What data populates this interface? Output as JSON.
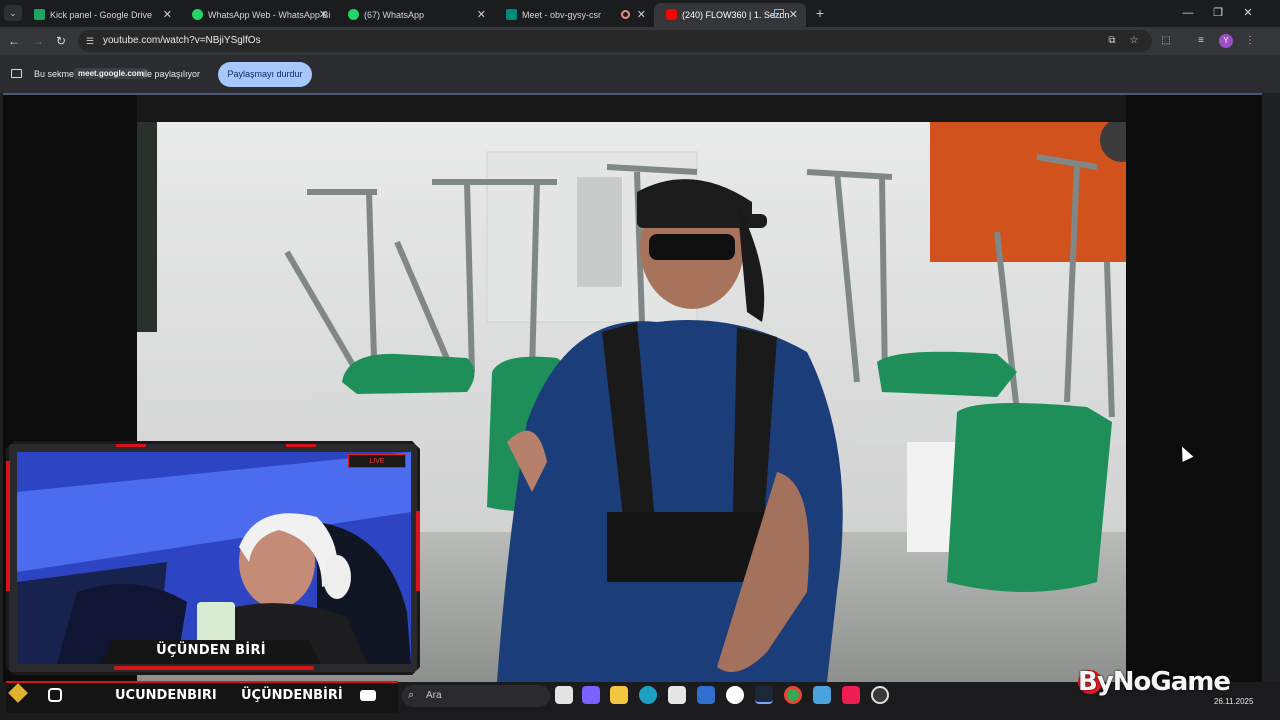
{
  "browser": {
    "tabs": [
      {
        "title": "Kick panel - Google Drive",
        "favicon": "google-drive-icon",
        "color": "#1fa463"
      },
      {
        "title": "WhatsApp Web - WhatsApp Bi",
        "favicon": "whatsapp-icon",
        "color": "#25d366"
      },
      {
        "title": "(67) WhatsApp",
        "favicon": "whatsapp-icon",
        "color": "#25d366"
      },
      {
        "title": "Meet - obv-gysy-csr",
        "favicon": "google-meet-icon",
        "color": "#00897b"
      },
      {
        "title": "(240) FLOW360 | 1. Sezon",
        "favicon": "youtube-icon",
        "color": "#ff0000",
        "active": true
      }
    ],
    "url": "youtube.com/watch?v=NBjiYSglfOs",
    "profile_initial": "Y"
  },
  "share_bar": {
    "prefix": "Bu sekme",
    "domain": "meet.google.com",
    "suffix": "ile paylaşılıyor",
    "stop_button": "Paylaşmayı durdur"
  },
  "overlay": {
    "cam_name": "ÜÇÜNDEN BİRİ",
    "live_label": "LIVE",
    "accent": "#d8141b",
    "social_instagram": "UCUNDENBIRI",
    "social_second": "ÜÇÜNDENBİRİ"
  },
  "taskbar": {
    "search_placeholder": "Ara",
    "time": "",
    "date": "26.11.2025"
  },
  "watermark": "ByNoGame"
}
